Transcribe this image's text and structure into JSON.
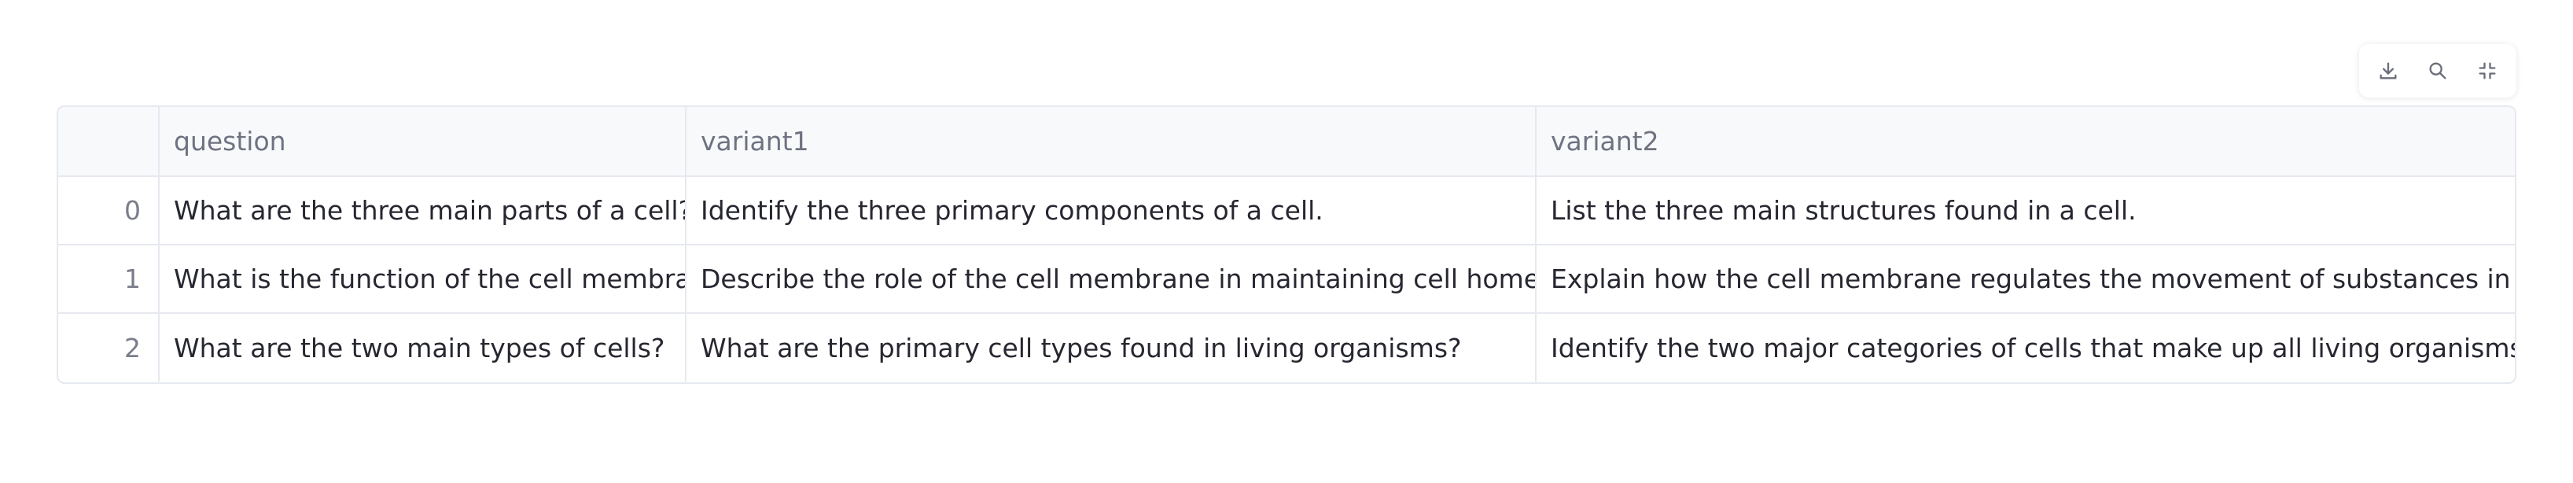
{
  "toolbar": {
    "download_icon": "download-icon",
    "search_icon": "search-icon",
    "collapse_icon": "collapse-icon"
  },
  "table": {
    "index_header": "",
    "columns": [
      "question",
      "variant1",
      "variant2"
    ],
    "rows": [
      {
        "index": "0",
        "question": "What are the three main parts of a cell?",
        "variant1": "Identify the three primary components of a cell.",
        "variant2": "List the three main structures found in a cell."
      },
      {
        "index": "1",
        "question": "What is the function of the cell membrane?",
        "variant1": "Describe the role of the cell membrane in maintaining cell homeostasis.",
        "variant2": "Explain how the cell membrane regulates the movement of substances in and out of t"
      },
      {
        "index": "2",
        "question": "What are the two main types of cells?",
        "variant1": "What are the primary cell types found in living organisms?",
        "variant2": "Identify the two major categories of cells that make up all living organisms."
      }
    ]
  },
  "colors": {
    "border": "#e6e9ef",
    "header_bg": "#f8f9fb",
    "header_text": "#6f7280",
    "cell_text": "#262730",
    "icon": "#6b6e7a"
  }
}
